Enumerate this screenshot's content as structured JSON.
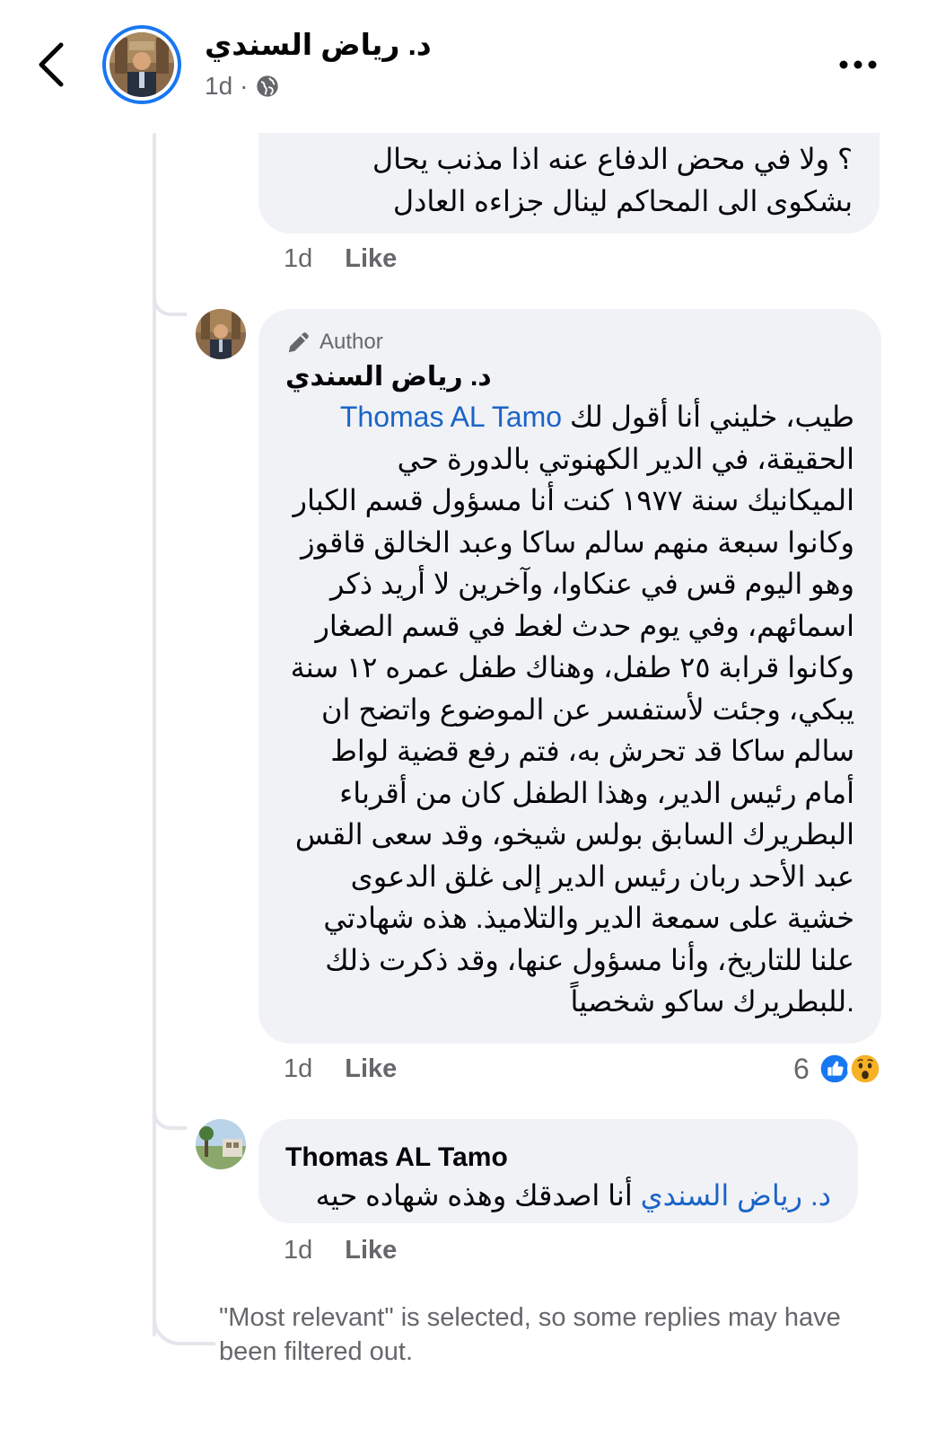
{
  "header": {
    "author_name": "د. رياض السندي",
    "time": "1d",
    "separator": "·",
    "icons": {
      "back": "back-chevron-icon",
      "privacy": "globe-icon",
      "more": "more-dots-icon"
    }
  },
  "comments": [
    {
      "text": "؟ ولا في محض الدفاع عنه اذا مذنب يحال بشكوى الى المحاكم لينال جزاءه العادل",
      "time": "1d",
      "like_label": "Like"
    },
    {
      "badge_label": "Author",
      "badge_icon": "pencil-icon",
      "author": "د. رياض السندي",
      "mention": "Thomas AL Tamo",
      "text": " طيب، خليني أنا أقول لك الحقيقة، في الدير الكهنوتي بالدورة حي الميكانيك سنة ١٩٧٧ كنت أنا مسؤول قسم الكبار وكانوا سبعة منهم سالم ساكا وعبد الخالق قاقوز وهو اليوم قس في عنكاوا، وآخرين لا أريد ذكر اسمائهم، وفي يوم حدث لغط في قسم الصغار وكانوا قرابة ٢٥ طفل، وهناك طفل عمره ١٢ سنة يبكي، وجئت لأستفسر عن الموضوع واتضح ان سالم ساكا قد تحرش به، فتم رفع قضية لواط أمام رئيس الدير، وهذا الطفل كان من أقرباء البطريرك السابق بولس شيخو، وقد سعى القس عبد الأحد ربان رئيس الدير إلى غلق الدعوى خشية على سمعة الدير والتلاميذ. هذه شهادتي علنا للتاريخ، وأنا مسؤول عنها، وقد ذكرت ذلك للبطريرك ساكو شخصياً.",
      "time": "1d",
      "like_label": "Like",
      "reaction_count": "6",
      "reaction_icons": [
        "like-reaction-icon",
        "wow-reaction-icon"
      ]
    },
    {
      "author": "Thomas AL Tamo",
      "mention": "د. رياض السندي",
      "text": " أنا اصدقك وهذه شهاده حيه",
      "time": "1d",
      "like_label": "Like"
    }
  ],
  "filter_note": "\"Most relevant\" is selected, so some replies may have been filtered out.",
  "colors": {
    "accent": "#1877f2",
    "mention": "#1b64c7",
    "bubble": "#f0f2f5",
    "muted": "#65676b"
  }
}
